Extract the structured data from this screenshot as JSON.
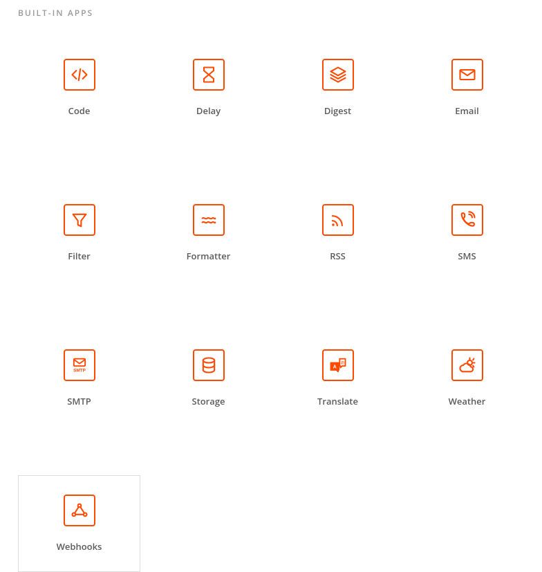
{
  "section_title": "BUILT-IN APPS",
  "colors": {
    "accent": "#ff4a00",
    "border": "#dcdcdc",
    "text": "#5a5a5a",
    "header": "#999"
  },
  "apps": [
    {
      "icon": "code",
      "label": "Code",
      "selected": false
    },
    {
      "icon": "delay",
      "label": "Delay",
      "selected": false
    },
    {
      "icon": "digest",
      "label": "Digest",
      "selected": false
    },
    {
      "icon": "email",
      "label": "Email",
      "selected": false
    },
    {
      "icon": "filter",
      "label": "Filter",
      "selected": false
    },
    {
      "icon": "formatter",
      "label": "Formatter",
      "selected": false
    },
    {
      "icon": "rss",
      "label": "RSS",
      "selected": false
    },
    {
      "icon": "sms",
      "label": "SMS",
      "selected": false
    },
    {
      "icon": "smtp",
      "label": "SMTP",
      "selected": false
    },
    {
      "icon": "storage",
      "label": "Storage",
      "selected": false
    },
    {
      "icon": "translate",
      "label": "Translate",
      "selected": false
    },
    {
      "icon": "weather",
      "label": "Weather",
      "selected": false
    },
    {
      "icon": "webhooks",
      "label": "Webhooks",
      "selected": true
    }
  ]
}
